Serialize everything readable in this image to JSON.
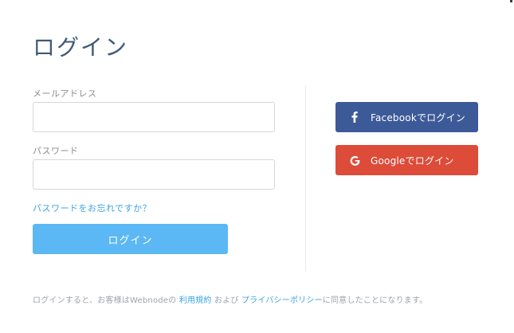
{
  "title": "ログイン",
  "email": {
    "label": "メールアドレス",
    "value": "",
    "placeholder": ""
  },
  "password": {
    "label": "パスワード",
    "value": "",
    "placeholder": ""
  },
  "forgot_password_link": "パスワードをお忘れですか？",
  "login_button": "ログイン",
  "social": {
    "facebook": {
      "label": "Facebookでログイン",
      "icon": "facebook-icon",
      "color": "#3d5a98"
    },
    "google": {
      "label": "Googleでログイン",
      "icon": "google-icon",
      "color": "#dd4b39"
    }
  },
  "footer": {
    "prefix": "ログインすると、お客様はWebnodeの",
    "terms_link": "利用規約",
    "middle": "および",
    "privacy_link": "プライバシーポリシー",
    "suffix": "に同意したことになります。"
  },
  "colors": {
    "accent": "#5bb8f5",
    "link": "#3aa3e3",
    "title": "#3f5a78"
  }
}
